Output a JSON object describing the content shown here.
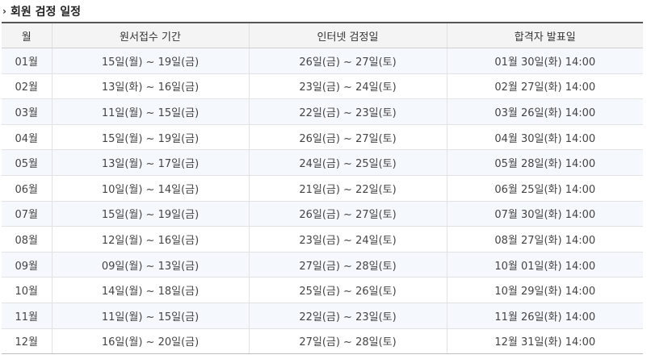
{
  "section": {
    "title": "회원 검정 일정",
    "icon": "chevron-right-icon"
  },
  "table": {
    "headers": [
      "월",
      "원서접수 기간",
      "인터넷 검정일",
      "합격자 발표일"
    ],
    "rows": [
      [
        "01월",
        "15일(월) ~ 19일(금)",
        "26일(금) ~ 27일(토)",
        "01월 30일(화) 14:00"
      ],
      [
        "02월",
        "13일(화) ~ 16일(금)",
        "23일(금) ~ 24일(토)",
        "02월 27일(화) 14:00"
      ],
      [
        "03월",
        "11일(월) ~ 15일(금)",
        "22일(금) ~ 23일(토)",
        "03월 26일(화) 14:00"
      ],
      [
        "04월",
        "15일(월) ~ 19일(금)",
        "26일(금) ~ 27일(토)",
        "04월 30일(화) 14:00"
      ],
      [
        "05월",
        "13일(월) ~ 17일(금)",
        "24일(금) ~ 25일(토)",
        "05월 28일(화) 14:00"
      ],
      [
        "06월",
        "10일(월) ~ 14일(금)",
        "21일(금) ~ 22일(토)",
        "06월 25일(화) 14:00"
      ],
      [
        "07월",
        "15일(월) ~ 19일(금)",
        "26일(금) ~ 27일(토)",
        "07월 30일(화) 14:00"
      ],
      [
        "08월",
        "12일(월) ~ 16일(금)",
        "23일(금) ~ 24일(토)",
        "08월 27일(화) 14:00"
      ],
      [
        "09월",
        "09일(월) ~ 13일(금)",
        "27일(금) ~ 28일(토)",
        "10월 01일(화) 14:00"
      ],
      [
        "10월",
        "14일(월) ~ 18일(금)",
        "25일(금) ~ 26일(토)",
        "10월 29일(화) 14:00"
      ],
      [
        "11월",
        "11일(월) ~ 15일(금)",
        "22일(금) ~ 23일(토)",
        "11월 26일(화) 14:00"
      ],
      [
        "12월",
        "16일(월) ~ 20일(금)",
        "27일(금) ~ 28일(토)",
        "12월 31일(화) 14:00"
      ]
    ]
  }
}
